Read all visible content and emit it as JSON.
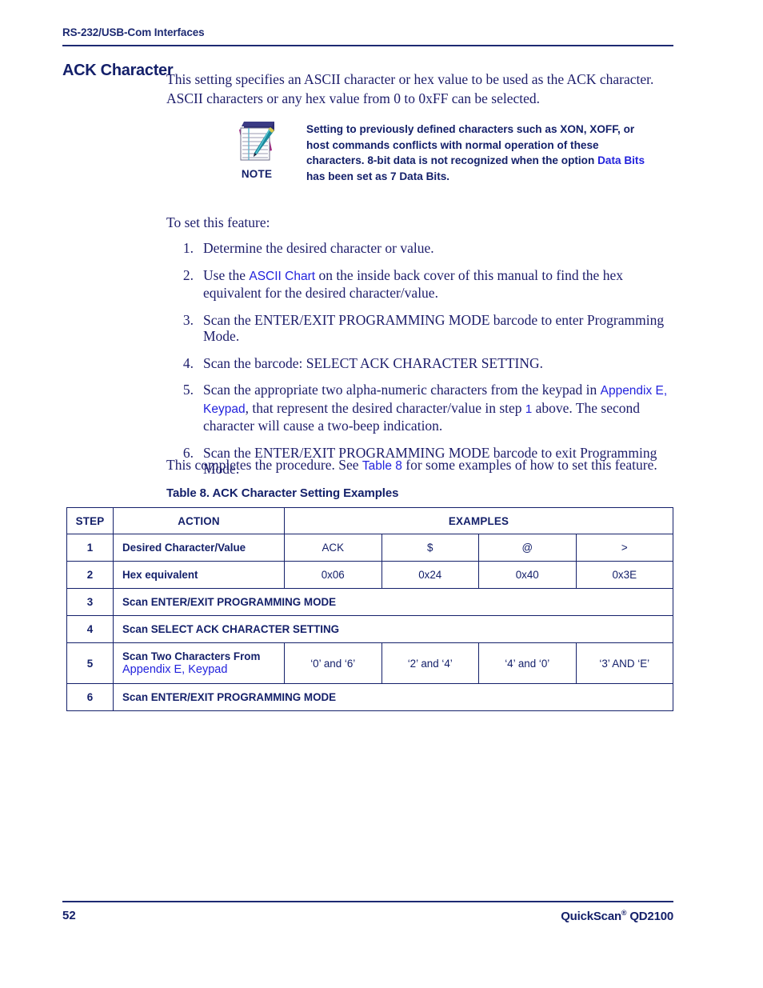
{
  "header": {
    "running_title": "RS-232/USB-Com Interfaces"
  },
  "section": {
    "title": "ACK Character",
    "intro": "This setting specifies an ASCII character or hex value to be used as the ACK character. ASCII characters or any hex value from 0 to 0xFF can be selected."
  },
  "note": {
    "icon": "notepad-pen-icon",
    "label": "NOTE",
    "text_part1": "Setting to previously defined characters such as XON, XOFF, or host commands conflicts with normal operation of these characters. 8-bit data is not recognized when the option ",
    "link": "Data Bits",
    "text_part2": " has been set as 7 Data Bits."
  },
  "procedure": {
    "lead_in": "To set this feature:",
    "steps": [
      {
        "num": "1.",
        "text": "Determine the desired character or value."
      },
      {
        "num": "2.",
        "pre": "Use the ",
        "link": "ASCII Chart",
        "post": " on the inside back cover of this manual to find the hex equivalent for the desired character/value."
      },
      {
        "num": "3.",
        "text": "Scan the ENTER/EXIT PROGRAMMING MODE barcode to enter Programming Mode."
      },
      {
        "num": "4.",
        "text": "Scan the barcode: SELECT ACK CHARACTER SETTING."
      },
      {
        "num": "5.",
        "pre": "Scan the appropriate two alpha-numeric characters from the keypad in ",
        "link": "Appendix E, Keypad",
        "mid": ", that represent the desired character/value in step ",
        "ref": "1",
        "post": " above. The second character will cause a two-beep indication."
      },
      {
        "num": "6.",
        "text": "Scan the ENTER/EXIT PROGRAMMING MODE barcode to exit Programming Mode."
      }
    ],
    "closing_pre": "This completes the procedure. See ",
    "closing_link": "Table 8",
    "closing_post": " for some examples of how to set this feature."
  },
  "table": {
    "caption": "Table 8. ACK Character Setting Examples",
    "headers": {
      "step": "STEP",
      "action": "ACTION",
      "examples": "EXAMPLES"
    },
    "rows": [
      {
        "step": "1",
        "action": "Desired Character/Value",
        "examples": [
          "ACK",
          "$",
          "@",
          ">"
        ]
      },
      {
        "step": "2",
        "action": "Hex equivalent",
        "examples": [
          "0x06",
          "0x24",
          "0x40",
          "0x3E"
        ]
      },
      {
        "step": "3",
        "action": "Scan ENTER/EXIT PROGRAMMING MODE",
        "examples": []
      },
      {
        "step": "4",
        "action": "Scan SELECT ACK CHARACTER SETTING",
        "examples": []
      },
      {
        "step": "5",
        "action": "Scan Two Characters From",
        "action_link": "Appendix E, Keypad",
        "examples": [
          "‘0’ and ‘6’",
          "‘2’ and ‘4’",
          "‘4’ and ‘0’",
          "‘3’ AND ‘E’"
        ]
      },
      {
        "step": "6",
        "action": "Scan ENTER/EXIT PROGRAMMING MODE",
        "examples": []
      }
    ]
  },
  "footer": {
    "page_number": "52",
    "product_name": "QuickScan",
    "product_mark": "®",
    "product_model": " QD2100"
  },
  "colors": {
    "navy": "#14206a",
    "body_text": "#1d1d6b",
    "link_blue": "#2222dd",
    "rule": "#1d2a72"
  }
}
